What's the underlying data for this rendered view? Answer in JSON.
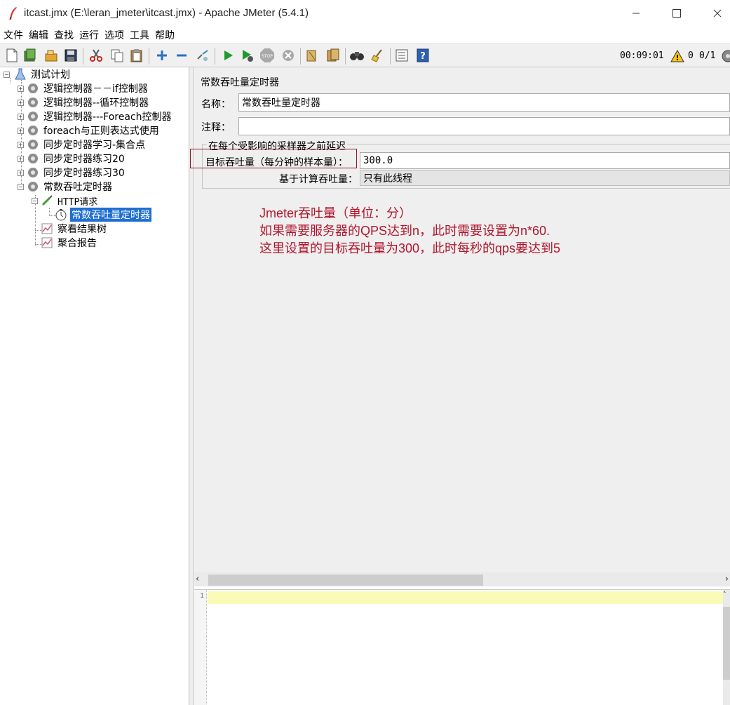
{
  "window": {
    "title": "itcast.jmx (E:\\leran_jmeter\\itcast.jmx) - Apache JMeter (5.4.1)",
    "minimize": "—",
    "maximize": "☐",
    "close": "✕"
  },
  "menu": [
    "文件",
    "编辑",
    "查找",
    "运行",
    "选项",
    "工具",
    "帮助"
  ],
  "toolbar": {
    "buttons": [
      "new-icon",
      "templates-icon",
      "open-icon",
      "save-icon",
      "cut-icon",
      "copy-icon",
      "paste-icon",
      "expand-icon",
      "collapse-icon",
      "toggle-icon",
      "start-icon",
      "start-no-pause-icon",
      "stop-icon",
      "shutdown-icon",
      "clear-icon",
      "clear-all-icon",
      "search-icon",
      "reset-search-icon",
      "function-helper-icon",
      "help-icon"
    ],
    "elapsed_time": "00:09:01",
    "warning_count": "0",
    "threads": "0/1"
  },
  "tree": {
    "root": "测试计划",
    "items": [
      "逻辑控制器－－if控制器",
      "逻辑控制器--循环控制器",
      "逻辑控制器---Foreach控制器",
      "foreach与正则表达式使用",
      "同步定时器学习-集合点",
      "同步定时器练习20",
      "同步定时器练习30",
      "常数吞吐定时器"
    ],
    "http_request": "HTTP请求",
    "selected_timer": "常数吞吐量定时器",
    "view_results_tree": "察看结果树",
    "aggregate_report": "聚合报告"
  },
  "panel": {
    "title": "常数吞吐量定时器",
    "name_label": "名称：",
    "name_value": "常数吞吐量定时器",
    "comment_label": "注释：",
    "comment_value": "",
    "group_legend": "在每个受影响的采样器之前延迟",
    "target_label": "目标吞吐量（每分钟的样本量）：",
    "target_value": "300.0",
    "calc_label": "基于计算吞吐量：",
    "calc_value": "只有此线程"
  },
  "annotation": {
    "line1": "Jmeter吞吐量（单位：分）",
    "line2": "如果需要服务器的QPS达到n，此时需要设置为n*60.",
    "line3": "这里设置的目标吞吐量为300，此时每秒的qps要达到5"
  },
  "editor": {
    "line_number": "1"
  },
  "colors": {
    "annotation_red": "#b0162b",
    "selection_blue": "#1f6fd1",
    "highlight_line": "#fbfbb8"
  }
}
